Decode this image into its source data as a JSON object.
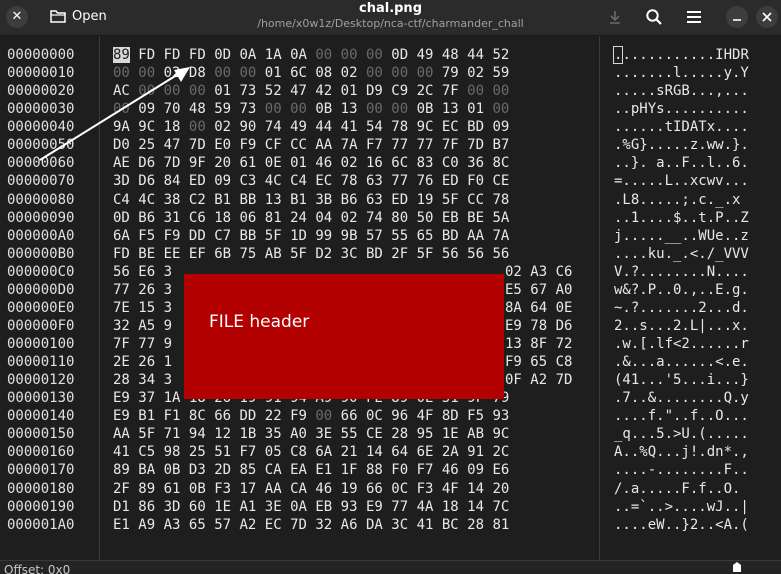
{
  "window": {
    "title": "chal.png",
    "path": "/home/x0w1z/Desktop/nca-ctf/charmander_chall"
  },
  "toolbar": {
    "open_label": "Open",
    "icons": [
      "close-icon",
      "folder-icon",
      "download-icon",
      "search-icon",
      "menu-icon",
      "minimize-icon",
      "close-window-icon"
    ]
  },
  "offsets": [
    "00000000",
    "00000010",
    "00000020",
    "00000030",
    "00000040",
    "00000050",
    "00000060",
    "00000070",
    "00000080",
    "00000090",
    "000000A0",
    "000000B0",
    "000000C0",
    "000000D0",
    "000000E0",
    "000000F0",
    "00000100",
    "00000110",
    "00000120",
    "00000130",
    "00000140",
    "00000150",
    "00000160",
    "00000170",
    "00000180",
    "00000190",
    "000001A0"
  ],
  "hex_rows": [
    "89 FD FD FD 0D 0A 1A 0A 00 00 00 0D 49 48 44 52",
    "00 00 02 D8 00 00 01 6C 08 02 00 00 00 79 02 59",
    "AC 00 00 00 01 73 52 47 42 01 D9 C9 2C 7F 00 00",
    "00 09 70 48 59 73 00 00 0B 13 00 00 0B 13 01 00",
    "9A 9C 18 00 02 90 74 49 44 41 54 78 9C EC BD 09",
    "D0 25 47 7D E0 F9 CF CC AA 7A F7 77 77 7F 7D B7",
    "AE D6 7D 9F 20 61 0E 01 46 02 16 6C 83 C0 36 8C",
    "3D D6 84 ED 09 C3 4C C4 EC 78 63 77 76 ED F0 CE",
    "C4 4C 38 C2 B1 BB 13 B1 3B B6 63 ED 19 5F CC 78",
    "0D B6 31 C6 18 06 81 24 04 02 74 80 50 EB BE 5A",
    "6A F5 F9 DD C7 BB 5F 1D 99 9B 57 55 65 BD AA 7A",
    "FD BE EE EF 6B 75 AB 5F D2 3C BD 2F 5F 56 56 56",
    "56 E6 3",
    "77 26 3",
    "7E 15 3",
    "32 A5 9",
    "7F 77 9",
    "2E 26 1",
    "28 34 3",
    "E9 37 1A 18 26 19 91 94 A9 90 FE 89 0E 51 9F 79",
    "E9 B1 F1 8C 66 DD 22 F9 00 66 0C 96 4F 8D F5 93",
    "AA 5F 71 94 12 1B 35 A0 3E 55 CE 28 95 1E AB 9C",
    "41 C5 98 25 51 F7 05 C8 6A 21 14 64 6E 2A 91 2C",
    "89 BA 0B D3 2D 85 CA EA E1 1F 88 F0 F7 46 09 E6",
    "2F 89 61 0B F3 17 AA CA 46 19 66 0C F3 4F 14 20",
    "D1 86 3D 60 1E A1 3E 0A EB 93 E9 77 4A 18 14 7C",
    "E1 A9 A3 65 57 A2 EC 7D 32 A6 DA 3C 41 BC 28 81"
  ],
  "hex_right_fragments": [
    "02 A3 C6",
    "E5 67 A0",
    "8A 64 0E",
    "E9 78 D6",
    "13 8F 72",
    "F9 65 C8",
    "0F A2 7D"
  ],
  "ascii_rows": [
    "............IHDR",
    ".......l.....y.Y",
    ".....sRGB...,...",
    "..pHYs..........",
    "......tIDATx....",
    ".%G}.....z.ww.}.",
    "..}. a..F..l..6.",
    "=.....L..xcwv...",
    ".L8.....;.c._.x",
    "..1....$..t.P..Z",
    "j.....__..WUe..z",
    "....ku._.<./_VVV",
    "V.?........N....",
    "w&?.P..0.,..E.g.",
    "~.?.......2...d.",
    "2..s...2.L|...x.",
    ".w.[.lf<2......r",
    ".&...a......<.e.",
    "(41...'5...i...}",
    ".7..&........Q.y",
    "....f.\"..f..O...",
    "_q...5.>U.(.....",
    "A..%Q...j!.dn*.,",
    "....-........F..",
    "/.a.....F.f..O.",
    "..=`..>....wJ..|",
    "....eW..}2..<A.("
  ],
  "overlay": {
    "label": "FILE header",
    "color": "#b30000"
  },
  "status": {
    "offset_label": "Offset: 0x0"
  },
  "colors": {
    "background": "#1e1e1e",
    "header": "#2b2b2b",
    "zero_byte": "#6a6a6a",
    "text": "#e8e8e8",
    "annotation_red": "#b30000"
  }
}
